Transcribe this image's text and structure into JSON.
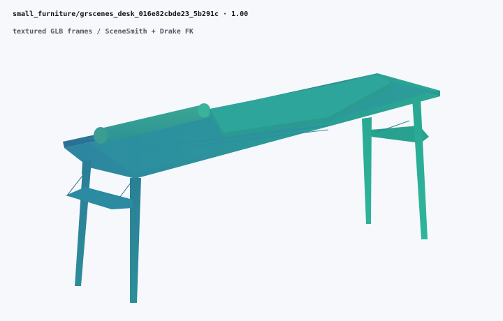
{
  "header": {
    "asset_path": "small_furniture/grscenes_desk_016e82cbde23_5b291c",
    "separator": "·",
    "scale": "1.00",
    "subtitle": "textured GLB frames / SceneSmith + Drake FK"
  },
  "scene": {
    "object": "desk",
    "colors": {
      "background": "#f6f8fc",
      "tint_left": "#2a6f95",
      "tint_right": "#2aa993"
    }
  }
}
